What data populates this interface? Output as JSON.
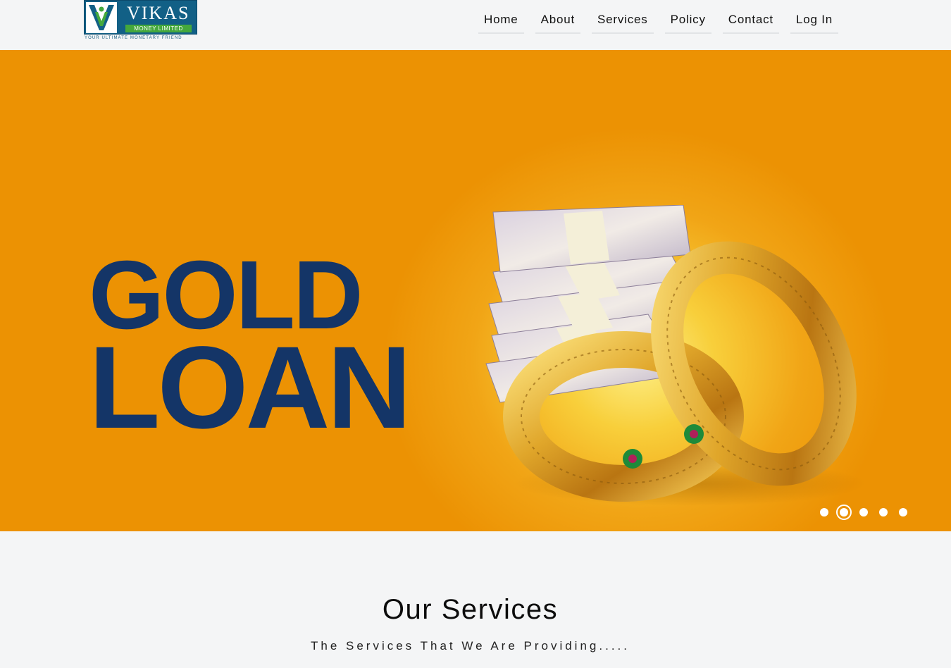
{
  "brand": {
    "name": "VIKAS",
    "band": "MONEY LIMITED",
    "tagline": "YOUR ULTIMATE MONETARY FRIEND",
    "logo_color": "#126086",
    "band_color": "#44a83c"
  },
  "nav": {
    "items": [
      {
        "label": "Home"
      },
      {
        "label": "About"
      },
      {
        "label": "Services"
      },
      {
        "label": "Policy"
      },
      {
        "label": "Contact"
      },
      {
        "label": "Log In"
      }
    ]
  },
  "hero": {
    "line1": "GOLD",
    "line2": "LOAN",
    "text_color": "#143567",
    "background_color": "#ec9203",
    "slide_count": 5,
    "active_slide": 2
  },
  "services": {
    "title": "Our Services",
    "subtitle": "The Services That We Are Providing....."
  }
}
